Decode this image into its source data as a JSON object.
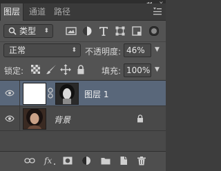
{
  "strip": {
    "collapse": "◂◂",
    "close": "×"
  },
  "tabs": [
    {
      "label": "图层",
      "active": true
    },
    {
      "label": "通道",
      "active": false
    },
    {
      "label": "路径",
      "active": false
    }
  ],
  "filter": {
    "kind_label": "类型",
    "icons": [
      "image-filter-icon",
      "adjustment-filter-icon",
      "type-filter-icon",
      "shape-filter-icon",
      "smart-object-filter-icon"
    ]
  },
  "blend": {
    "mode": "正常",
    "opacity_label": "不透明度:",
    "opacity_value": "46%"
  },
  "lock": {
    "label": "锁定:",
    "fill_label": "填充:",
    "fill_value": "100%"
  },
  "layers": [
    {
      "name": "图层 1",
      "selected": true,
      "has_mask": true,
      "locked": false
    },
    {
      "name": "背景",
      "selected": false,
      "has_mask": false,
      "locked": true,
      "italic": true
    }
  ],
  "bottom_icons": [
    "link-layers-icon",
    "fx-icon",
    "add-mask-icon",
    "adjustment-layer-icon",
    "new-group-icon",
    "new-layer-icon",
    "delete-layer-icon"
  ],
  "colors": {
    "panel_bg": "#535353",
    "selected_row": "#59677a",
    "text": "#d8d8d8"
  }
}
